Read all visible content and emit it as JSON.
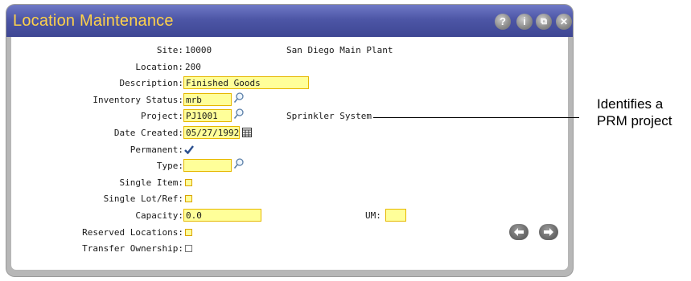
{
  "window": {
    "title": "Location Maintenance",
    "buttons": {
      "help": "?",
      "info": "i",
      "restore": "⧉",
      "close": "✕"
    }
  },
  "form": {
    "site_label": "Site:",
    "site_value": "10000",
    "site_name": "San Diego Main Plant",
    "location_label": "Location:",
    "location_value": "200",
    "description_label": "Description:",
    "description_value": "Finished Goods",
    "inventory_status_label": "Inventory Status:",
    "inventory_status_value": "mrb",
    "project_label": "Project:",
    "project_value": "PJ1001",
    "project_name": "Sprinkler System",
    "date_created_label": "Date Created:",
    "date_created_value": "05/27/1992",
    "permanent_label": "Permanent:",
    "permanent_checked": true,
    "type_label": "Type:",
    "type_value": "",
    "single_item_label": "Single Item:",
    "single_lot_ref_label": "Single Lot/Ref:",
    "capacity_label": "Capacity:",
    "capacity_value": "0.0",
    "um_label": "UM:",
    "um_value": "",
    "reserved_locations_label": "Reserved Locations:",
    "transfer_ownership_label": "Transfer Ownership:"
  },
  "annotation": {
    "line1": "Identifies a",
    "line2": "PRM project"
  },
  "colors": {
    "title_bar": "#4d56a6",
    "title_text": "#ffd24a",
    "field_bg": "#ffff99",
    "field_border": "#e6b800",
    "frame": "#b7b7b7"
  }
}
